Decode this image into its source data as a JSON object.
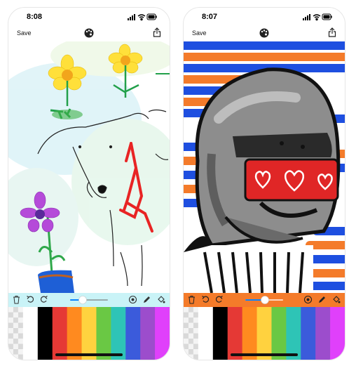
{
  "screens": [
    {
      "id": "left",
      "status": {
        "time": "8:08"
      },
      "nav": {
        "save_label": "Save",
        "palette_icon": "palette-icon",
        "share_icon": "share-icon"
      },
      "toolbar": {
        "background": "#c9f3f7",
        "icons": [
          "trash-icon",
          "undo-icon",
          "redo-icon",
          "brush-size-slider",
          "stamp-icon",
          "pencil-icon",
          "fill-bucket-icon"
        ]
      },
      "swatches": [
        "#ffffff",
        "#000000",
        "#e53935",
        "#ff8a1f",
        "#ffd23f",
        "#6ac844",
        "#2ec4b6",
        "#3b5bdb",
        "#9c4dcc",
        "#e040fb"
      ],
      "drawing": "flowers-and-dog"
    },
    {
      "id": "right",
      "status": {
        "time": "8:07"
      },
      "nav": {
        "save_label": "Save",
        "palette_icon": "palette-icon",
        "share_icon": "share-icon"
      },
      "toolbar": {
        "background": "#f47b2a",
        "icons": [
          "trash-icon",
          "undo-icon",
          "redo-icon",
          "brush-size-slider",
          "stamp-icon",
          "pencil-icon",
          "fill-bucket-icon"
        ]
      },
      "swatches": [
        "#ffffff",
        "#000000",
        "#e53935",
        "#ff8a1f",
        "#ffd23f",
        "#6ac844",
        "#2ec4b6",
        "#3b5bdb",
        "#9c4dcc",
        "#e040fb"
      ],
      "drawing": "robot-helmet-with-hearts"
    }
  ]
}
